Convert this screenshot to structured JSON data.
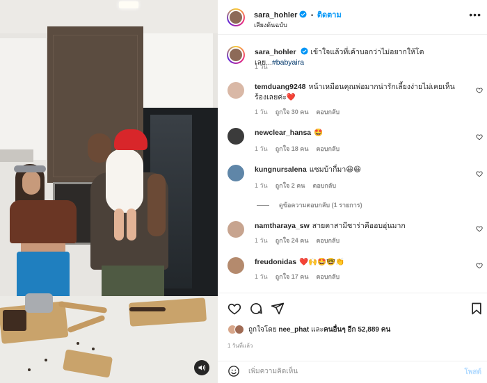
{
  "post": {
    "author": "sara_hohler",
    "follow_label": "ติดตาม",
    "separator": "•",
    "audio": "เสียงต้นฉบับ",
    "menu": "•••"
  },
  "caption": {
    "username": "sara_hohler",
    "text": "เข้าใจแล้วที่เค้าบอกว่าไม่อยากให้โตเลย...",
    "hashtag": "#babyaira",
    "time": "1 วัน"
  },
  "comments": [
    {
      "username": "temduang9248",
      "text": "หน้าเหมือนคุณพ่อมากน่ารักเลี้ยงง่ายไม่เคยเห็นร้องเลยค่ะ❤️",
      "time": "1 วัน",
      "likes": "ถูกใจ 30 คน",
      "reply": "ตอบกลับ",
      "avatar_color": "#d9b8a6"
    },
    {
      "username": "newclear_hansa",
      "text": "🤩",
      "time": "1 วัน",
      "likes": "ถูกใจ 18 คน",
      "reply": "ตอบกลับ",
      "avatar_color": "#3b3b3b"
    },
    {
      "username": "kungnursalena",
      "text": "แซมบ้ากี่มา😆😆",
      "time": "1 วัน",
      "likes": "ถูกใจ 2 คน",
      "reply": "ตอบกลับ",
      "avatar_color": "#5f86a8"
    },
    {
      "username": "namtharaya_sw",
      "text": "สายตาสามีซาร่าคืออบอุ่นมาก",
      "time": "1 วัน",
      "likes": "ถูกใจ 24 คน",
      "reply": "ตอบกลับ",
      "avatar_color": "#c7a48f"
    },
    {
      "username": "freudonidas",
      "text": "❤️🙌🤩🤓👏",
      "time": "1 วัน",
      "likes": "ถูกใจ 17 คน",
      "reply": "ตอบกลับ",
      "avatar_color": "#b48a6d"
    }
  ],
  "view_replies": "ดูข้อความตอบกลับ (1 รายการ)",
  "likes": {
    "prefix": "ถูกใจโดย",
    "user": "nee_phat",
    "middle": "และ",
    "others": "คนอื่นๆ อีก 52,889 คน"
  },
  "timeago": "1 วันที่แล้ว",
  "add_comment": {
    "placeholder": "เพิ่มความคิดเห็น",
    "post_label": "โพสต์"
  },
  "colors": {
    "accent": "#0095f6",
    "like_red": "#ed4956",
    "muted": "#8e8e8e"
  },
  "icons": [
    "mute-icon",
    "verified-icon",
    "heart-icon",
    "comment-icon",
    "share-icon",
    "bookmark-icon",
    "emoji-icon"
  ]
}
